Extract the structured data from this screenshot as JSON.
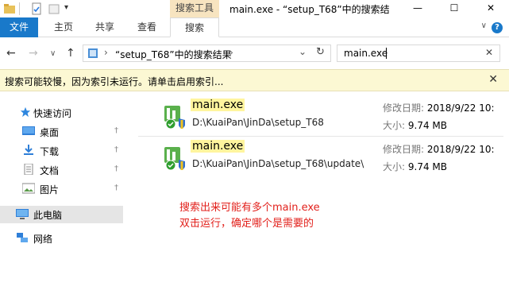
{
  "window": {
    "title": "main.exe - “setup_T68”中的搜索结",
    "tool_tab": "搜索工具",
    "minimize": "—",
    "maximize": "☐",
    "close": "✕",
    "qa_dropdown": "▾"
  },
  "ribbon": {
    "tabs": [
      {
        "label": "文件"
      },
      {
        "label": "主页"
      },
      {
        "label": "共享"
      },
      {
        "label": "查看"
      },
      {
        "label": "搜索"
      }
    ],
    "expand": "∨",
    "help": "?"
  },
  "nav": {
    "back": "←",
    "forward": "→",
    "recent": "∨",
    "up": "↑",
    "breadcrumb": "“setup_T68”中的搜索结果",
    "breadcrumb_sep": "›",
    "breadcrumb_chevron": "›",
    "refresh": "↻",
    "search_value": "main.exe",
    "search_clear": "✕"
  },
  "infobar": {
    "message": "搜索可能较慢，因为索引未运行。请单击启用索引...",
    "close": "✕"
  },
  "sidebar": {
    "quick_access": "快速访问",
    "items": [
      {
        "label": "桌面",
        "icon": "desktop-icon"
      },
      {
        "label": "下载",
        "icon": "download-icon"
      },
      {
        "label": "文档",
        "icon": "document-icon"
      },
      {
        "label": "图片",
        "icon": "pictures-icon"
      }
    ],
    "pin_glyph": "†",
    "this_pc": "此电脑",
    "network": "网络"
  },
  "results": [
    {
      "name": "main.exe",
      "path": "D:\\KuaiPan\\JinDa\\setup_T68",
      "modified_label": "修改日期:",
      "modified_value": "2018/9/22 10:",
      "size_label": "大小:",
      "size_value": "9.74 MB"
    },
    {
      "name": "main.exe",
      "path": "D:\\KuaiPan\\JinDa\\setup_T68\\update\\",
      "modified_label": "修改日期:",
      "modified_value": "2018/9/22 10:",
      "size_label": "大小:",
      "size_value": "9.74 MB"
    }
  ],
  "annotation": {
    "line1": "搜索出来可能有多个main.exe",
    "line2": "双击运行，确定哪个是需要的"
  },
  "colors": {
    "accent": "#1979ca",
    "tool_tab_bg": "#f7e4c0",
    "infobar_bg": "#fcf8d3",
    "highlight": "#fff59e",
    "annotation": "#e2211c"
  }
}
